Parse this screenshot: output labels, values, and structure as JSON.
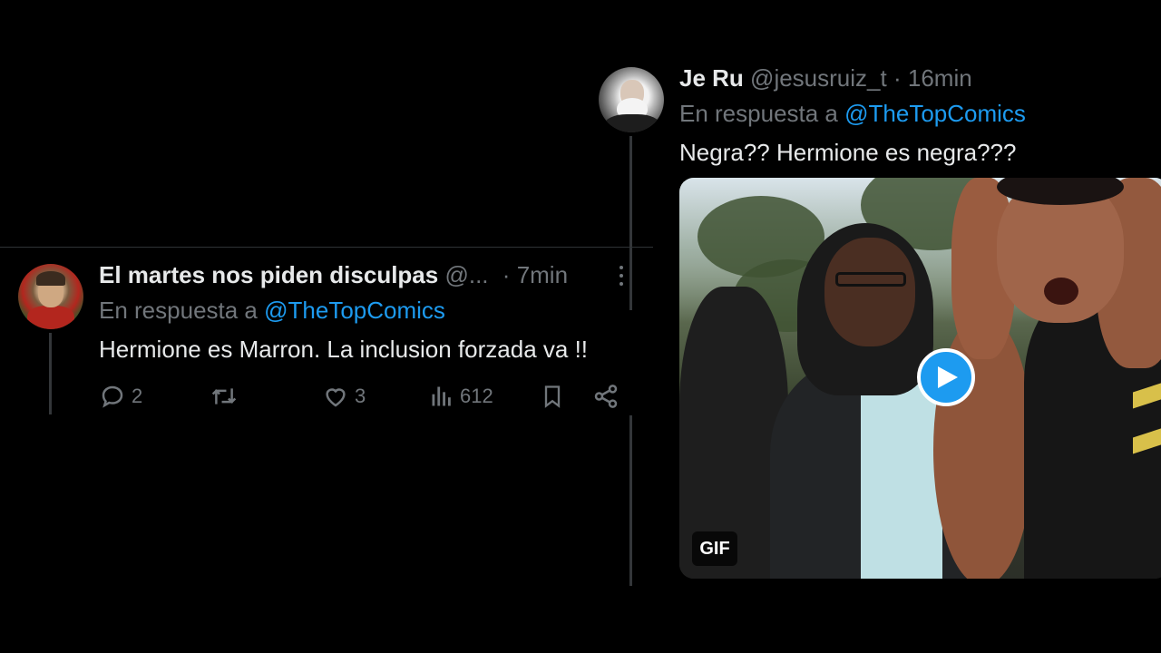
{
  "right_tweet": {
    "display_name": "Je Ru",
    "handle": "@jesusruiz_t",
    "separator": "·",
    "time": "16min",
    "reply_prefix": "En respuesta a",
    "reply_mention": "@TheTopComics",
    "text": "Negra?? Hermione es negra???",
    "media": {
      "type": "gif",
      "badge": "GIF",
      "play_icon": "play-icon"
    }
  },
  "left_tweet": {
    "display_name": "El martes nos piden disculpas",
    "handle": "@...",
    "separator": "·",
    "time": "7min",
    "reply_prefix": "En respuesta a",
    "reply_mention": "@TheTopComics",
    "text": "Hermione es Marron. La inclusion forzada va !!",
    "actions": {
      "reply_count": "2",
      "retweet_count": "",
      "like_count": "3",
      "views_count": "612"
    }
  },
  "colors": {
    "background": "#000000",
    "text_primary": "#e7e9ea",
    "text_muted": "#71767b",
    "accent": "#1d9bf0",
    "thread_line": "#333639"
  }
}
